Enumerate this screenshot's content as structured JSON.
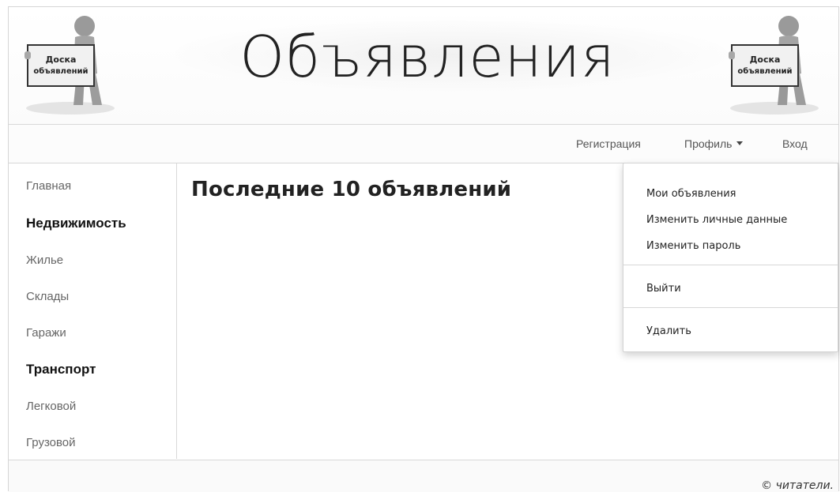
{
  "header": {
    "title": "Объявления",
    "mascot_sign": [
      "Доска",
      "объявлений"
    ]
  },
  "navbar": {
    "register": "Регистрация",
    "profile": "Профиль",
    "login": "Вход"
  },
  "sidebar": {
    "items": [
      {
        "label": "Главная",
        "bold": false
      },
      {
        "label": "Недвижимость",
        "bold": true
      },
      {
        "label": "Жилье",
        "bold": false
      },
      {
        "label": "Склады",
        "bold": false
      },
      {
        "label": "Гаражи",
        "bold": false
      },
      {
        "label": "Транспорт",
        "bold": true
      },
      {
        "label": "Легковой",
        "bold": false
      },
      {
        "label": "Грузовой",
        "bold": false
      }
    ]
  },
  "main": {
    "title": "Последние 10 объявлений"
  },
  "profile_menu": {
    "items": [
      "Мои объявления",
      "Изменить личные данные",
      "Изменить пароль",
      "Выйти",
      "Удалить"
    ]
  },
  "footer": {
    "text": "© читатели."
  },
  "colors": {
    "text": "#222222",
    "muted": "#666666",
    "border": "#d8d8d8"
  }
}
